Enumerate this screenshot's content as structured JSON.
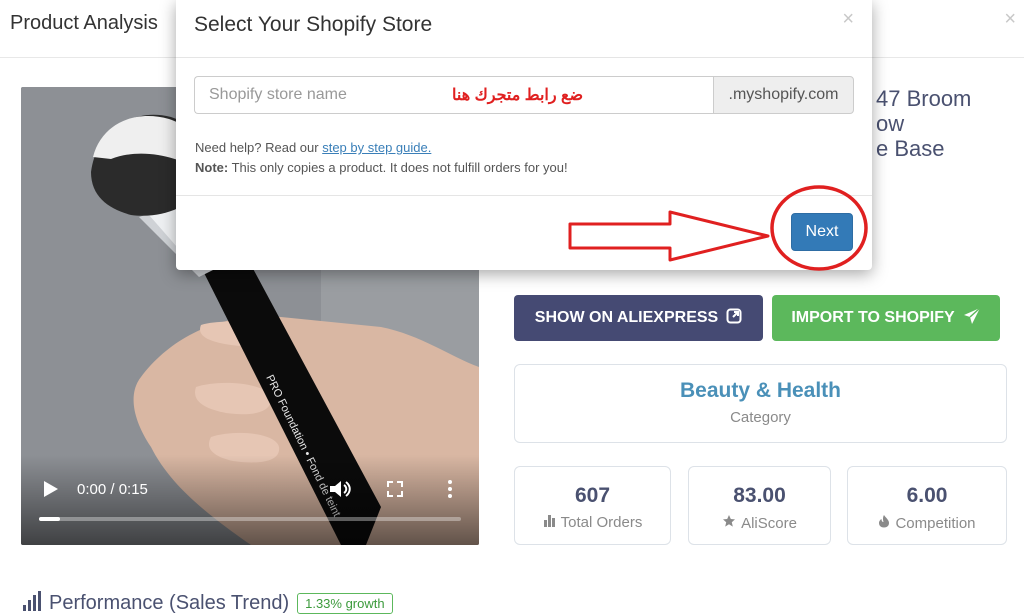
{
  "page": {
    "title": "Product Analysis",
    "close_glyph": "×",
    "product_title": "47 Broom\now\ne Base"
  },
  "video": {
    "time": "0:00 / 0:15",
    "progress": 0.05,
    "handle_text": "PRO Foundation • Fond de teint",
    "icons": [
      "play-icon",
      "volume-icon",
      "fullscreen-icon",
      "more-vert-icon"
    ]
  },
  "actions": {
    "show_ali": "SHOW ON ALIEXPRESS",
    "import": "IMPORT TO SHOPIFY"
  },
  "category": {
    "value": "Beauty & Health",
    "label": "Category"
  },
  "stats": [
    {
      "value": "607",
      "label": "Total Orders",
      "icon": "bar-chart-icon"
    },
    {
      "value": "83.00",
      "label": "AliScore",
      "icon": "star-icon"
    },
    {
      "value": "6.00",
      "label": "Competition",
      "icon": "fire-icon"
    }
  ],
  "performance": {
    "title": "Performance (Sales Trend)",
    "growth": "1.33% growth"
  },
  "modal": {
    "title": "Select Your Shopify Store",
    "close_glyph": "×",
    "input_placeholder": "Shopify store name",
    "input_value": "",
    "addon": ".myshopify.com",
    "arabic_annotation": "ضع رابط متجرك هنا",
    "help_prefix": "Need help? Read our ",
    "help_link": "step by step guide.",
    "note_label": "Note:",
    "note_text": " This only copies a product. It does not fulfill orders for you!",
    "next_label": "Next"
  },
  "colors": {
    "primary": "#337ab7",
    "ali_button": "#454a73",
    "shopify_button": "#5cb85c",
    "annotation_red": "#e02020",
    "category_text": "#4a90b8"
  }
}
